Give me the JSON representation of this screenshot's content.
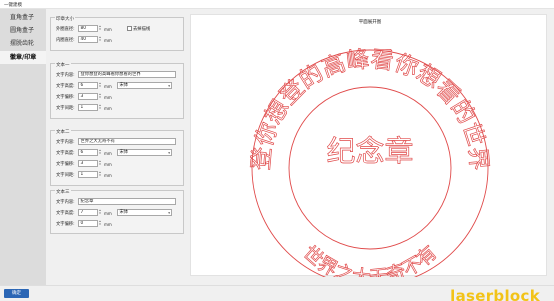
{
  "window": {
    "title": "一键建模"
  },
  "sidebar": {
    "items": [
      {
        "label": "直角盒子",
        "active": false
      },
      {
        "label": "圆角盒子",
        "active": false
      },
      {
        "label": "摆脱齿轮",
        "active": false
      },
      {
        "label": "徽章/印章",
        "active": true
      }
    ]
  },
  "seal_size": {
    "title": "印章大小",
    "outer_label": "外圈直径:",
    "outer_value": "80",
    "inner_label": "内圈直径:",
    "inner_value": "40",
    "unit": "mm",
    "outline_label": "去掉描线"
  },
  "text1": {
    "title": "文本一",
    "content_label": "文字内容:",
    "content_value": "登你想登的高峰看你想看的世界",
    "height_label": "文字高度:",
    "height_value": "6",
    "font_label": "宋体",
    "offset_label": "文字偏移:",
    "offset_value": "3",
    "spacing_label": "文字间距:",
    "spacing_value": "1",
    "unit": "mm"
  },
  "text2": {
    "title": "文本二",
    "content_label": "文字内容:",
    "content_value": "世界之大无奇不有",
    "height_label": "文字高度:",
    "height_value": "6",
    "font_label": "宋体",
    "offset_label": "文字偏移:",
    "offset_value": "3",
    "spacing_label": "文字间距:",
    "spacing_value": "1",
    "unit": "mm"
  },
  "text3": {
    "title": "文本三",
    "content_label": "文字内容:",
    "content_value": "纪念章",
    "height_label": "文字高度:",
    "height_value": "7",
    "font_label": "宋体",
    "offset_label": "文字偏移:",
    "offset_value": "0",
    "unit": "mm"
  },
  "preview": {
    "title": "平面展开图",
    "outer_text": "登你想登的高峰看你想看的世界",
    "bottom_text": "世界之大无奇不有",
    "center_text": "纪念章",
    "stroke_color": "#e04a4a"
  },
  "footer": {
    "confirm_label": "确定",
    "brand": "laserblock",
    "brand_color": "#f2c318"
  }
}
